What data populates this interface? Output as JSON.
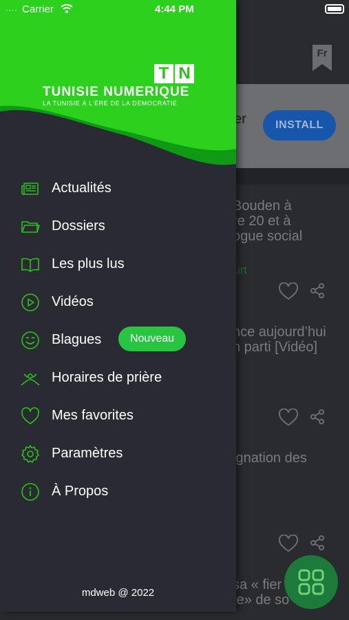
{
  "status_bar": {
    "carrier": "Carrier",
    "time": "4:44 PM"
  },
  "header": {
    "logo_letters": [
      "T",
      "N"
    ],
    "title": "TUNISIE NUMERIQUE",
    "subtitle": "LA TUNISIE À L'ÈRE DE LA DEMOCRATIE"
  },
  "menu": {
    "items": [
      {
        "label": "Actualités",
        "icon": "newspaper-icon"
      },
      {
        "label": "Dossiers",
        "icon": "folder-icon"
      },
      {
        "label": "Les plus lus",
        "icon": "book-icon"
      },
      {
        "label": "Vidéos",
        "icon": "play-icon"
      },
      {
        "label": "Blagues",
        "icon": "smiley-icon"
      },
      {
        "label": "Horaires de prière",
        "icon": "prayer-icon"
      },
      {
        "label": "Mes favorites",
        "icon": "heart-icon"
      },
      {
        "label": "Paramètres",
        "icon": "gear-icon"
      },
      {
        "label": "À Propos",
        "icon": "info-icon"
      }
    ],
    "badge": "Nouveau"
  },
  "footer": {
    "text": "mdweb @ 2022"
  },
  "background": {
    "lang_button": "Fr",
    "ad": {
      "text_fragment": "er",
      "install_label": "INSTALL"
    },
    "feed_lines": [
      "Bouden à",
      "re 20 et à",
      "ogue social",
      "urt",
      "nce aujourd’hui",
      "n parti [Vidéo]",
      "ignation des",
      "sa « fier",
      "te» de so"
    ]
  },
  "colors": {
    "accent_green": "#2bc21a",
    "drawer_bg": "#2a2b32",
    "badge_green": "#27c542",
    "install_blue": "#1656ab"
  }
}
